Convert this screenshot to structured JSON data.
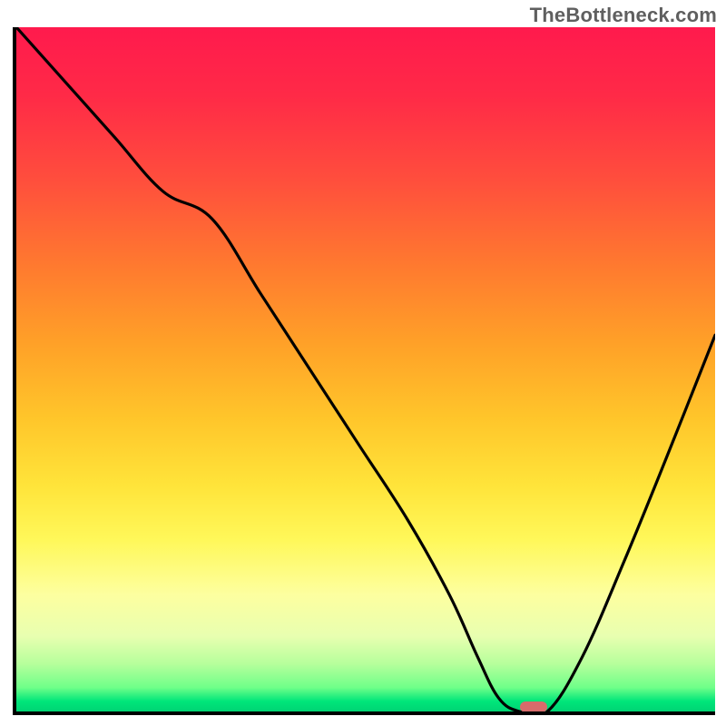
{
  "watermark": "TheBottleneck.com",
  "chart_data": {
    "type": "line",
    "title": "",
    "xlabel": "",
    "ylabel": "",
    "xlim": [
      0,
      100
    ],
    "ylim": [
      0,
      100
    ],
    "grid": false,
    "background": "vertical red-to-green gradient (bottleneck severity)",
    "series": [
      {
        "name": "bottleneck-curve",
        "x": [
          0,
          7,
          14,
          21,
          28,
          35,
          42,
          49,
          56,
          62,
          66,
          69,
          72,
          76,
          81,
          87,
          93,
          100
        ],
        "y": [
          100,
          92,
          84,
          76,
          72,
          61,
          50,
          39,
          28,
          17,
          8,
          2,
          0,
          0,
          8,
          22,
          37,
          55
        ]
      }
    ],
    "marker": {
      "x": 74,
      "y": 0.7,
      "color": "#d86b6b",
      "shape": "pill"
    },
    "legend": null
  }
}
